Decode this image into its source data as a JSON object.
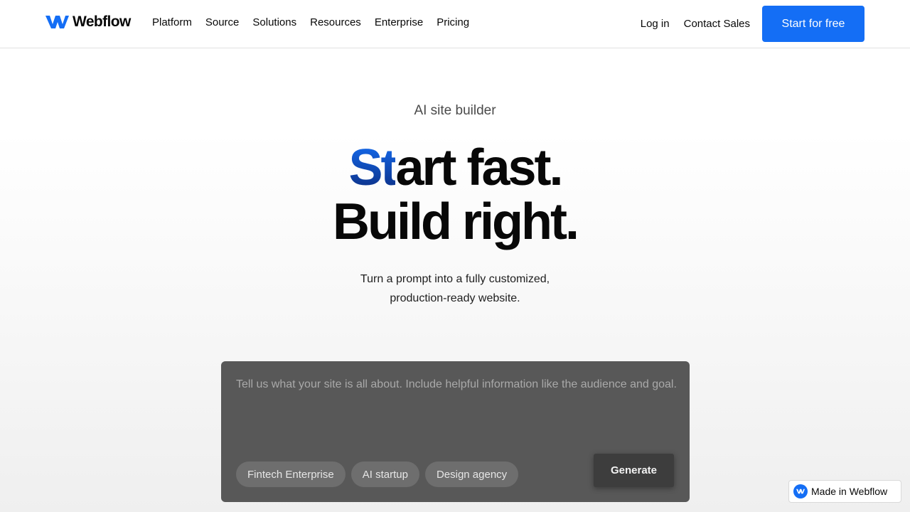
{
  "brand": {
    "name": "Webflow",
    "accent_color": "#146ef5"
  },
  "nav": {
    "links": [
      "Platform",
      "Source",
      "Solutions",
      "Resources",
      "Enterprise",
      "Pricing"
    ],
    "login": "Log in",
    "contact": "Contact Sales",
    "cta": "Start for free"
  },
  "hero": {
    "eyebrow": "AI site builder",
    "headline_accent": "St",
    "headline_line1_rest": "art fast.",
    "headline_line2": "Build right.",
    "subhead_line1": "Turn a prompt into a fully customized,",
    "subhead_line2": "production-ready website."
  },
  "prompt": {
    "placeholder": "Tell us what your site is all about. Include helpful information like the audience and goal.",
    "chips": [
      "Fintech Enterprise",
      "AI startup",
      "Design agency"
    ],
    "generate": "Generate"
  },
  "badge": {
    "text": "Made in Webflow",
    "icon": "webflow-logo-icon"
  }
}
